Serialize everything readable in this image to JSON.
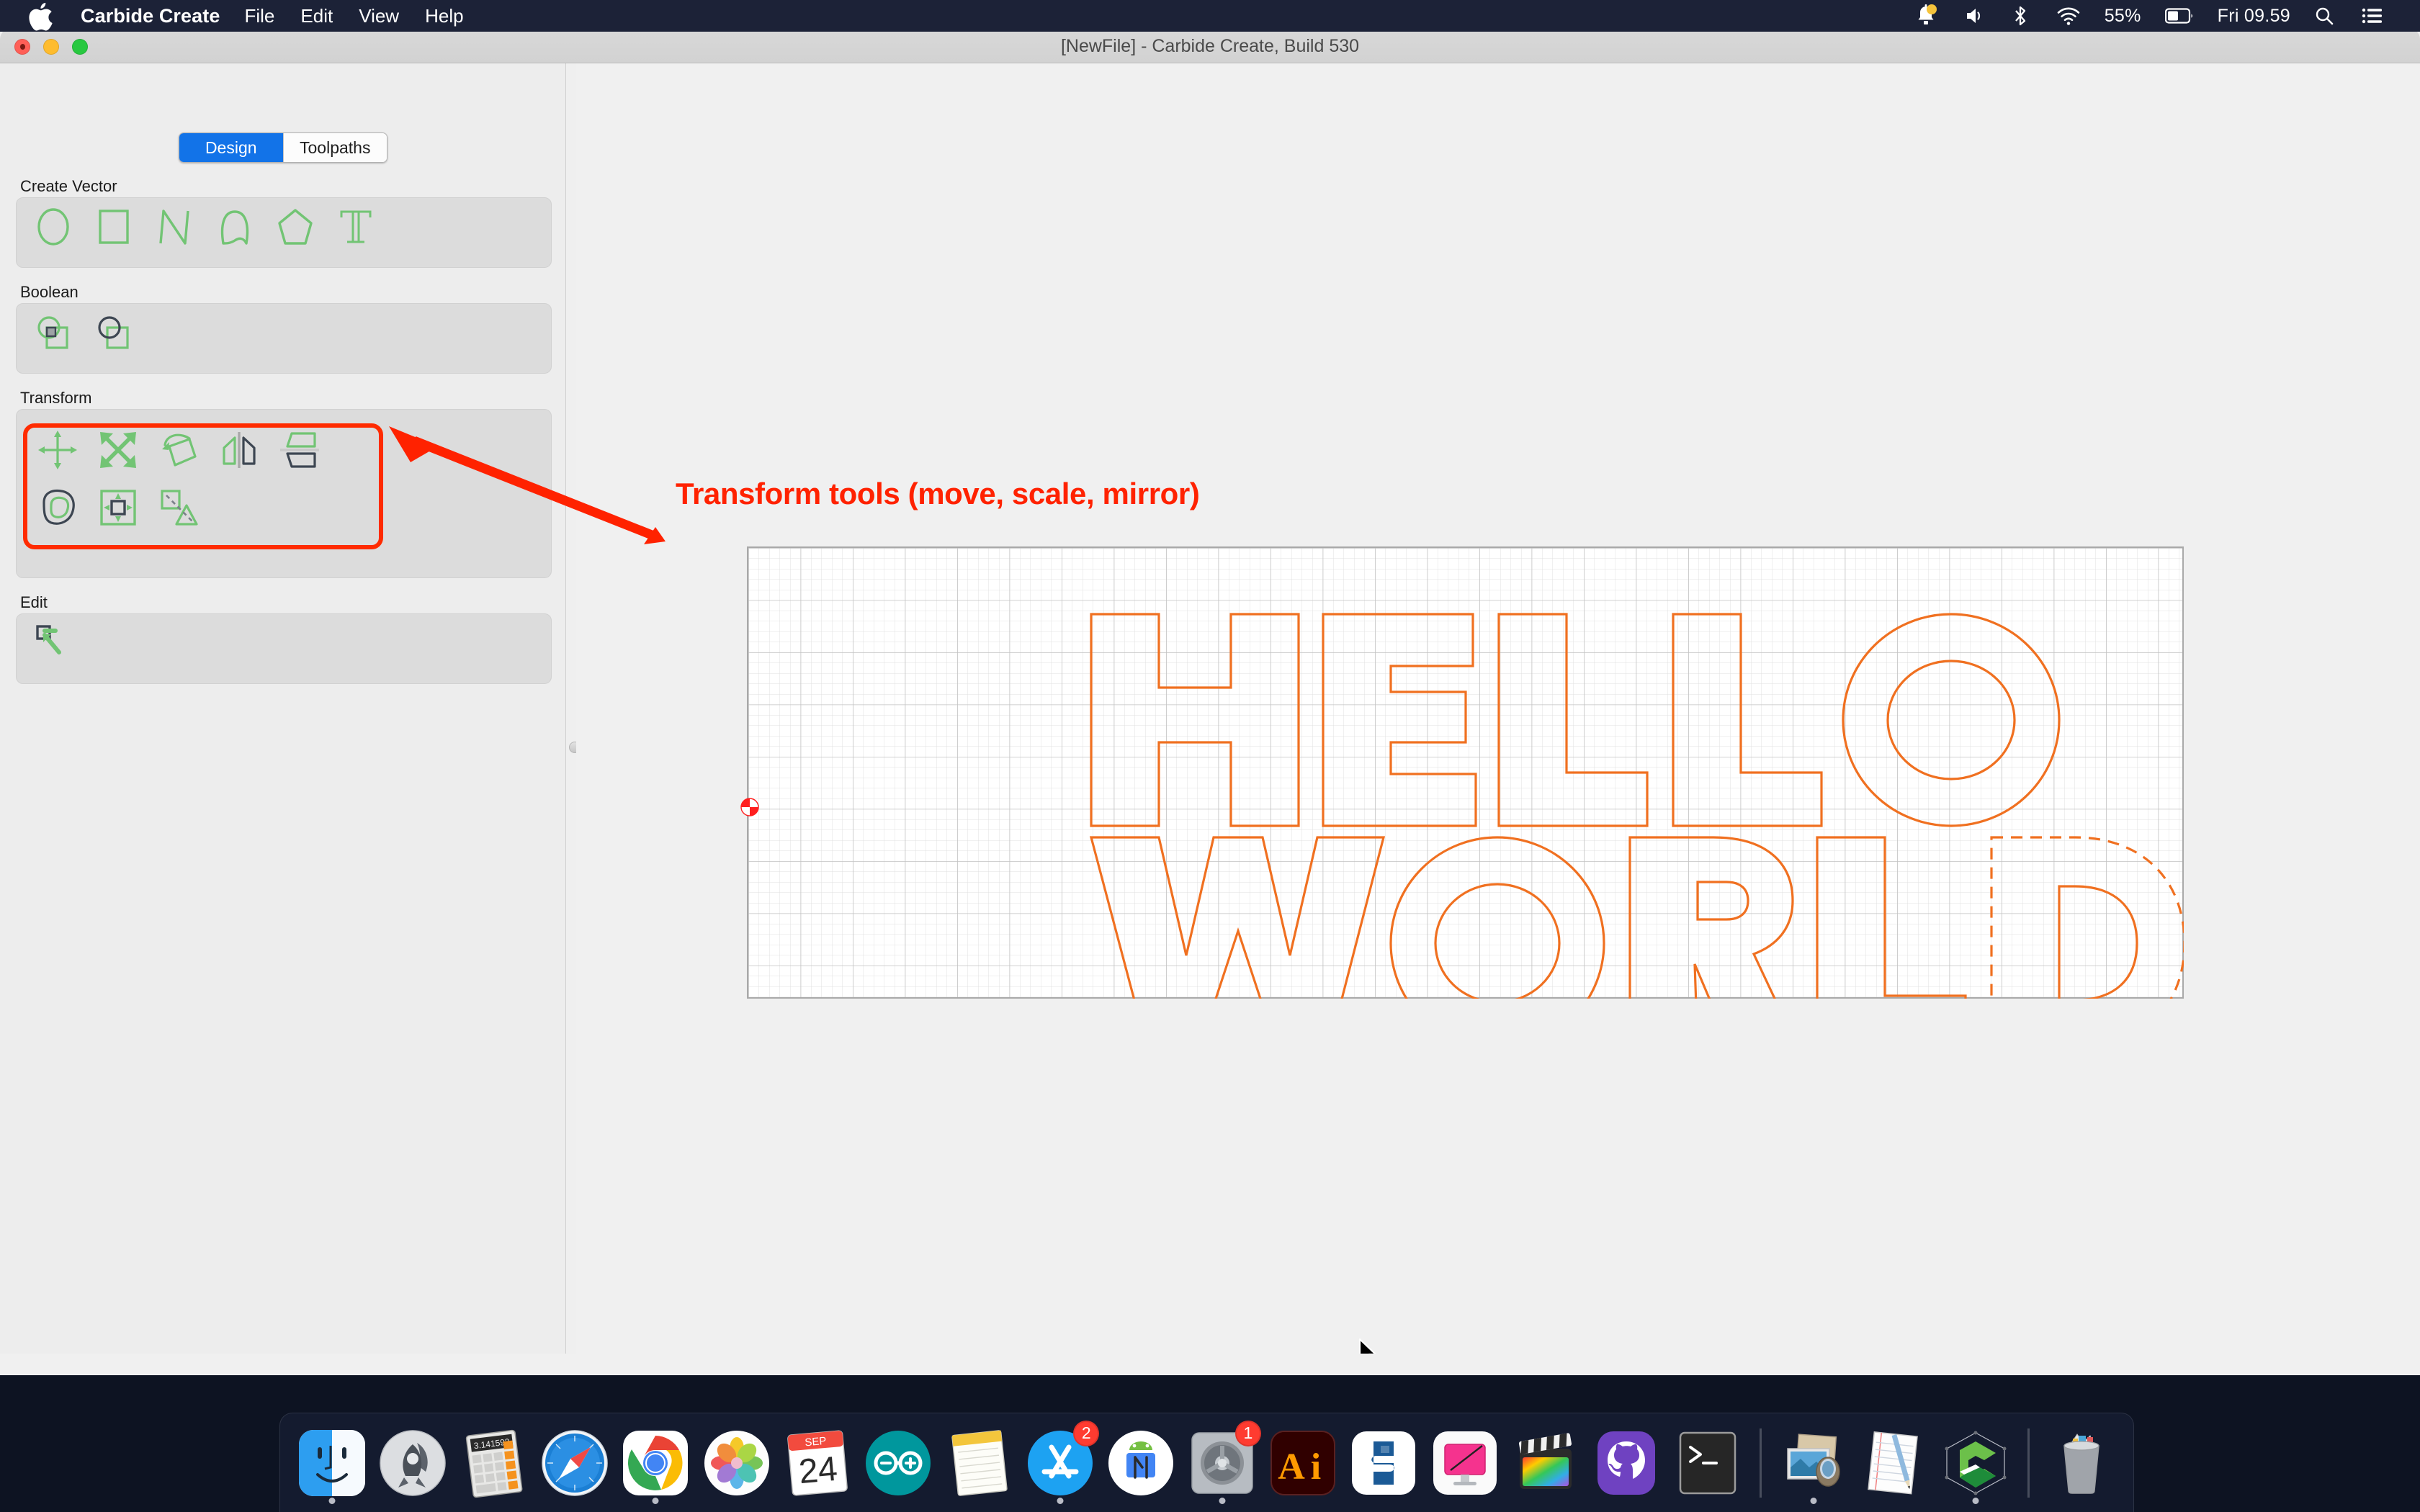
{
  "menubar": {
    "apple_icon": "apple-logo",
    "app_name": "Carbide Create",
    "items": [
      "File",
      "Edit",
      "View",
      "Help"
    ],
    "status": {
      "notification_icon": "bell-icon",
      "volume_icon": "speaker-icon",
      "bluetooth_icon": "bluetooth-icon",
      "wifi_icon": "wifi-icon",
      "battery_percent": "55%",
      "battery_icon": "battery-icon",
      "clock": "Fri 09.59",
      "search_icon": "search-icon",
      "controlcenter_icon": "control-center-icon"
    }
  },
  "window": {
    "title": "[NewFile] - Carbide Create, Build 530",
    "traffic_lights": [
      "close-button",
      "minimize-button",
      "zoom-button"
    ]
  },
  "sidebar": {
    "tabs": [
      {
        "label": "Design",
        "active": true
      },
      {
        "label": "Toolpaths",
        "active": false
      }
    ],
    "sections": [
      {
        "label": "Create Vector",
        "tools": [
          "circle-tool",
          "rectangle-tool",
          "polyline-tool",
          "curve-tool",
          "polygon-tool",
          "text-tool"
        ]
      },
      {
        "label": "Boolean",
        "tools": [
          "boolean-union-tool",
          "boolean-subtract-tool"
        ]
      },
      {
        "label": "Transform",
        "tools": [
          "move-tool",
          "scale-tool",
          "rotate-tool",
          "mirror-tool",
          "flip-tool",
          "offset-tool",
          "array-tool",
          "duplicate-tool"
        ]
      },
      {
        "label": "Edit",
        "tools": [
          "node-edit-tool"
        ]
      }
    ]
  },
  "annotation": {
    "text": "Transform tools (move, scale, mirror)",
    "color": "#ff2200",
    "arrow": "red-arrow-pointing-left",
    "highlight": "red-rounded-rect-around-transform-group"
  },
  "canvas": {
    "origin_marker": "origin-marker",
    "design_text_line1": "HELLO",
    "design_text_line2": "WORLD",
    "vector_color": "#f07020",
    "grid_color": "#d7d7d7",
    "selected_glyph": "D",
    "selection_style": "dashed-outline",
    "cursor": "arrow-cursor"
  },
  "dock": {
    "items": [
      {
        "name": "finder",
        "running": true
      },
      {
        "name": "launchpad",
        "running": false
      },
      {
        "name": "calculator",
        "running": false
      },
      {
        "name": "safari",
        "running": false
      },
      {
        "name": "chrome",
        "running": true
      },
      {
        "name": "photos",
        "running": false
      },
      {
        "name": "calendar",
        "running": false,
        "month": "SEP",
        "day": "24"
      },
      {
        "name": "arduino",
        "running": false
      },
      {
        "name": "notes",
        "running": false
      },
      {
        "name": "app-store",
        "running": true,
        "badge": "2"
      },
      {
        "name": "android-studio",
        "running": false
      },
      {
        "name": "system-preferences",
        "running": true,
        "badge": "1"
      },
      {
        "name": "illustrator",
        "running": false
      },
      {
        "name": "sketchup",
        "running": false
      },
      {
        "name": "screen-app",
        "running": false
      },
      {
        "name": "final-cut-pro",
        "running": false
      },
      {
        "name": "github-desktop",
        "running": false
      },
      {
        "name": "terminal",
        "running": false
      },
      {
        "name": "separator",
        "running": false
      },
      {
        "name": "image-capture",
        "running": true
      },
      {
        "name": "textedit",
        "running": false
      },
      {
        "name": "carbide-create",
        "running": true
      },
      {
        "name": "separator2",
        "running": false
      },
      {
        "name": "trash",
        "running": false
      }
    ]
  }
}
